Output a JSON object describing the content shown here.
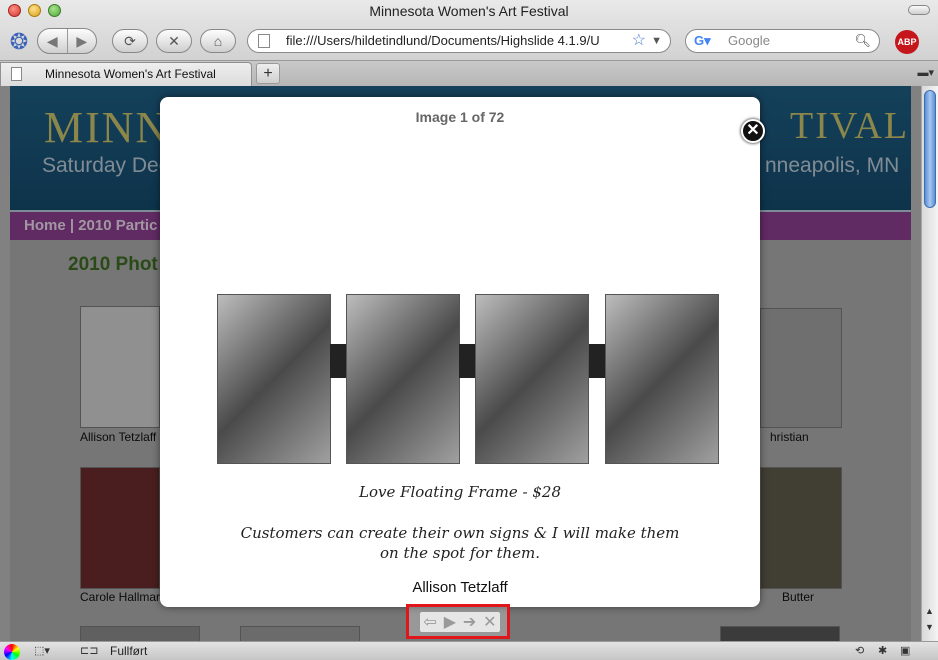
{
  "window": {
    "title": "Minnesota Women's Art Festival"
  },
  "toolbar": {
    "back_icon": "◀",
    "forward_icon": "▶",
    "reload_icon": "⟳",
    "stop_icon": "✕",
    "home_icon": "⌂",
    "url": "file:///Users/hildetindlund/Documents/Highslide 4.1.9/U",
    "search_placeholder": "Google",
    "abp_label": "ABP"
  },
  "tabs": [
    {
      "label": "Minnesota Women's Art Festival"
    }
  ],
  "page": {
    "banner_title_left": "MINN",
    "banner_title_right": "TIVAL",
    "banner_sub_left": "Saturday Dece",
    "banner_sub_right": "nneapolis, MN",
    "menu": "Home | 2010 Partic",
    "heading": "2010 Phot",
    "thumbs": [
      {
        "label": "Allison Tetzlaff"
      },
      {
        "label": "hristian"
      },
      {
        "label": "Carole Hallmar"
      },
      {
        "label": "Butter"
      }
    ]
  },
  "popup": {
    "counter": "Image 1 of 72",
    "close_icon": "✕",
    "caption_title": "Love Floating Frame - $28",
    "caption_line1": "Customers can create their own signs & I will make them",
    "caption_line2": "on the spot for them.",
    "artist": "Allison Tetzlaff",
    "controls": {
      "prev": "⇦",
      "play": "▶",
      "next": "➔",
      "close": "✕"
    }
  },
  "status": {
    "text": "Fullført"
  },
  "colors": {
    "banner": "#1e5d82",
    "menu": "#8a3d8e",
    "heading": "#3d6a22",
    "highlight": "#e0161a"
  }
}
